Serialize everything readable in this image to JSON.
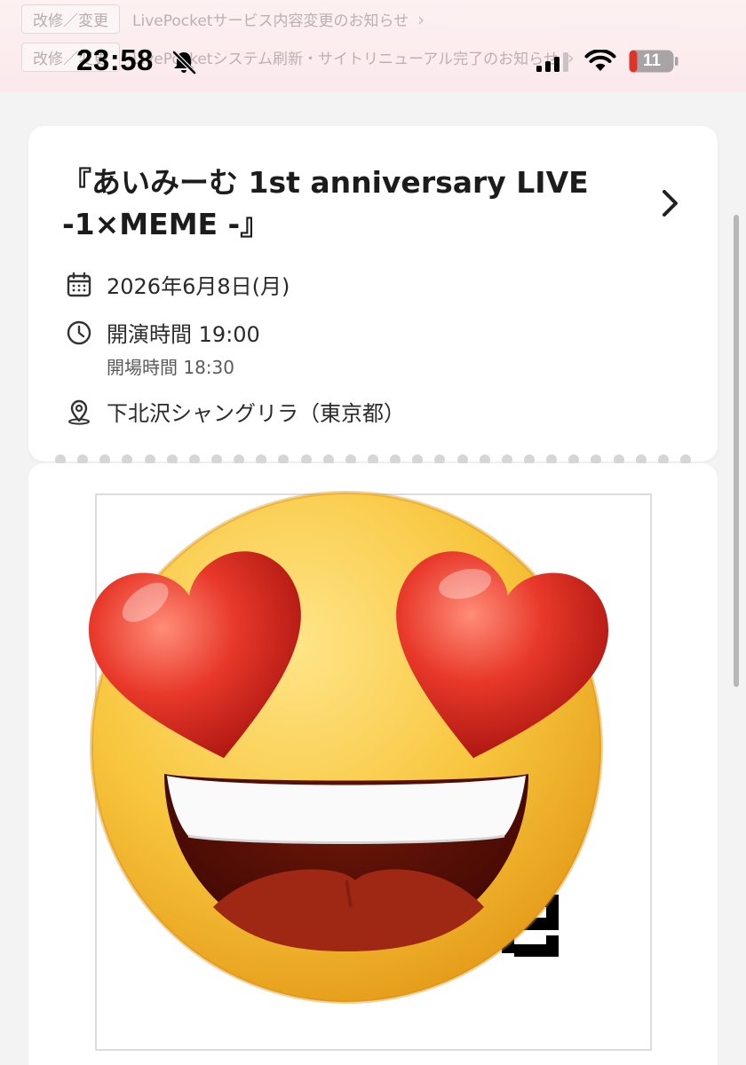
{
  "news": {
    "items": [
      {
        "tag": "改修／変更",
        "text": "LivePocketサービス内容変更のお知らせ"
      },
      {
        "tag": "改修／変更",
        "text": "LivePocketシステム刷新・サイトリニューアル完了のお知らせ"
      }
    ]
  },
  "status_bar": {
    "time": "23:58",
    "battery": "11",
    "icons": [
      "bell-slash-icon",
      "signal-icon",
      "wifi-icon",
      "battery-icon"
    ]
  },
  "event": {
    "title_line1": "『あいみーむ 1st anniversary LIVE",
    "title_line2": "-1×MEME -』",
    "date": "2026年6月8日(月)",
    "start_time": "開演時間 19:00",
    "open_time": "開場時間 18:30",
    "venue": "下北沢シャングリラ（東京都）",
    "icons": [
      "calendar-icon",
      "clock-icon",
      "map-pin-icon",
      "chevron-right-icon"
    ]
  },
  "ticket": {
    "overlay_icon": "heart-eyes-emoji"
  },
  "colors": {
    "banner_bg": "#fbe9ec",
    "page_bg": "#f3f3f3",
    "card_bg": "#ffffff",
    "heart_red": "#e0332a",
    "emoji_yellow": "#f6c23a"
  }
}
